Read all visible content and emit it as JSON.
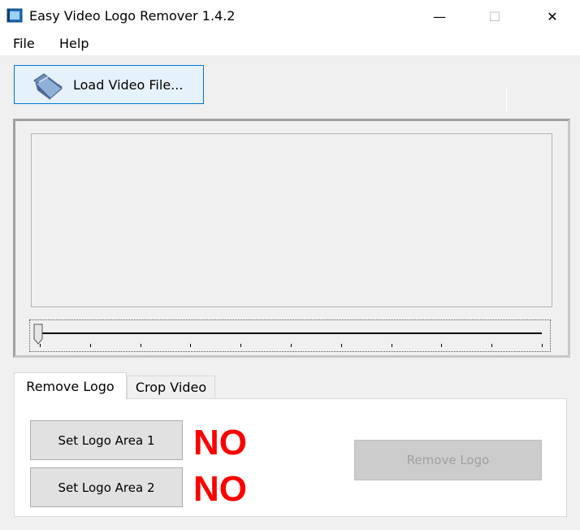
{
  "window": {
    "title": "Easy Video Logo Remover 1.4.2",
    "minimize": "—",
    "maximize": "☐",
    "close": "✕"
  },
  "menu": {
    "items": [
      {
        "label": "File"
      },
      {
        "label": "Help"
      }
    ]
  },
  "toolbar": {
    "load_label": "Load Video File..."
  },
  "tabs": [
    {
      "label": "Remove Logo",
      "active": true
    },
    {
      "label": "Crop Video",
      "active": false
    }
  ],
  "remove_logo": {
    "area1_label": "Set Logo Area 1",
    "area1_status": "NO",
    "area2_label": "Set Logo Area 2",
    "area2_status": "NO",
    "remove_label": "Remove Logo",
    "remove_enabled": false
  },
  "slider": {
    "position": 0,
    "ticks": 11
  },
  "colors": {
    "status_no": "#ff0000",
    "accent": "#0078d7"
  }
}
